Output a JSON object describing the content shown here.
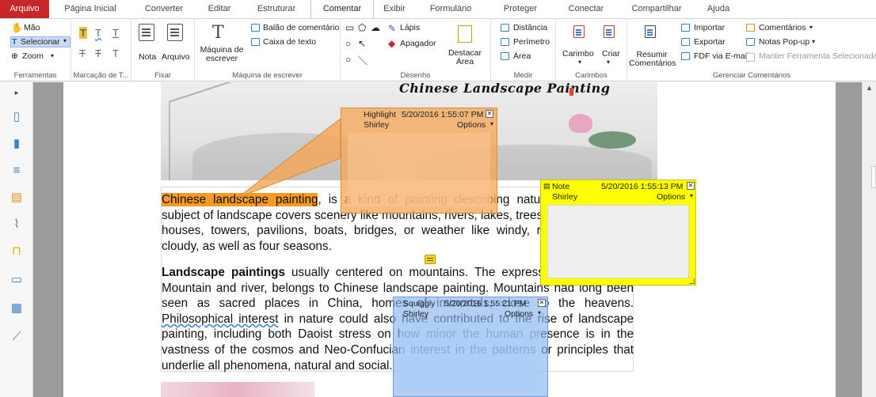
{
  "menu": {
    "tabs": [
      {
        "label": "Arquivo"
      },
      {
        "label": "Página Inicial"
      },
      {
        "label": "Converter"
      },
      {
        "label": "Editar"
      },
      {
        "label": "Estruturar"
      },
      {
        "label": "Comentar"
      },
      {
        "label": "Exibir"
      },
      {
        "label": "Formulário"
      },
      {
        "label": "Proteger"
      },
      {
        "label": "Conectar"
      },
      {
        "label": "Compartilhar"
      },
      {
        "label": "Ajuda"
      }
    ],
    "active": "Comentar"
  },
  "ribbon": {
    "ferramentas": {
      "name": "Ferramentas",
      "hand": "Mão",
      "select": "Selecionar",
      "zoom": "Zoom"
    },
    "markup": {
      "name": "Marcação de T..."
    },
    "fixar": {
      "name": "Fixar",
      "note": "Nota",
      "file": "Arquivo"
    },
    "typewriter": {
      "name": "Máquina de escrever",
      "typewriter_line1": "Máquina de",
      "typewriter_line2": "escrever",
      "callout": "Balão de comentário",
      "textbox": "Caixa de texto"
    },
    "desenho": {
      "name": "Desenho",
      "pencil": "Lápis",
      "eraser": "Apagador",
      "highlight_area_1": "Destacar",
      "highlight_area_2": "Área"
    },
    "medir": {
      "name": "Medir",
      "distance": "Distância",
      "perimeter": "Perímetro",
      "area": "Área"
    },
    "carimbos": {
      "name": "Carimbos",
      "stamp": "Carimbo",
      "create": "Criar"
    },
    "gerenciar": {
      "name": "Gerenciar Comentários",
      "summarize_1": "Resumir",
      "summarize_2": "Comentários",
      "import": "Importar",
      "export": "Exportar",
      "fdf_email": "FDF via E-mail",
      "comments": "Comentários",
      "popup_notes": "Notas Pop-up",
      "keep_tool": "Manter Ferramenta Selecionada"
    }
  },
  "document": {
    "banner_title": "Chinese Landscape Painting",
    "p1_highlight": "Chinese landscape painting",
    "p1_rest": ", is a kind of painting describing natural scenery. The subject of landscape covers scenery like mountains, rivers, lakes, trees, flowers, stones, houses, towers, pavilions, boats, bridges, or weather like windy, rainy, snowy and cloudy, as well as four seasons.",
    "p2_bold": "Landscape paintings",
    "p2_a": " usually centered on mountains. The expression of painting--Mountain and river, belongs to Chinese landscape painting. Mountains had long been seen as sacred places in China, homes of immortals, close to the heavens. ",
    "p2_squiggly": "Philosophical interest",
    "p2_b": " in nature could also have contributed to the rise of landscape painting, including both Daoist stress on how minor the human presence is in the vastness of the cosmos and Neo-Confucian interest in the patterns or principles that underlie all phenomena, natural and social."
  },
  "annotations": {
    "highlight": {
      "type": "Highlight",
      "date": "5/20/2016 1:55:07 PM",
      "author": "Shirley",
      "options": "Options"
    },
    "note": {
      "type": "Note",
      "date": "5/20/2016 1:55:13 PM",
      "author": "Shirley",
      "options": "Options"
    },
    "squiggly": {
      "type": "Squiggly",
      "date": "5/20/2016 1:55:21 PM",
      "author": "Shirley",
      "options": "Options"
    }
  },
  "colors": {
    "file_tab": "#c9262b",
    "highlight": "#f59a23",
    "note": "#ffff00",
    "squiggly": "#8ab4f0"
  }
}
